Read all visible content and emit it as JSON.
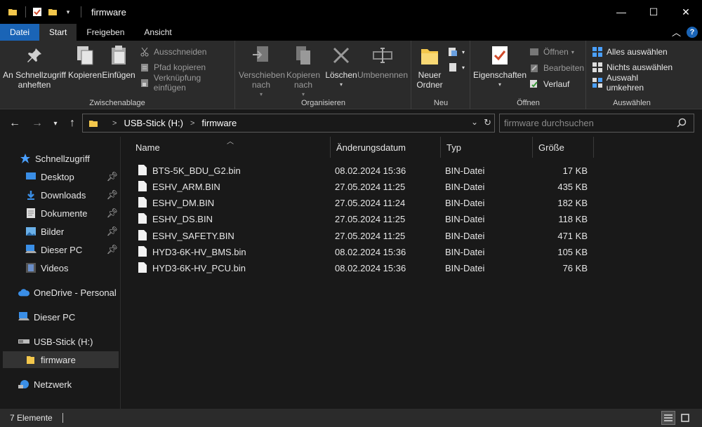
{
  "window": {
    "title": "firmware",
    "controls": {
      "minimize": "—",
      "maximize": "☐",
      "close": "✕"
    }
  },
  "ribbon_tabs": [
    "Datei",
    "Start",
    "Freigeben",
    "Ansicht"
  ],
  "ribbon": {
    "clipboard": {
      "label": "Zwischenablage",
      "pin": "An Schnellzugriff anheften",
      "copy": "Kopieren",
      "paste": "Einfügen",
      "cut": "Ausschneiden",
      "copy_path": "Pfad kopieren",
      "paste_shortcut": "Verknüpfung einfügen"
    },
    "organize": {
      "label": "Organisieren",
      "move_to": "Verschieben nach",
      "copy_to": "Kopieren nach",
      "delete": "Löschen",
      "rename": "Umbenennen"
    },
    "new": {
      "label": "Neu",
      "new_folder": "Neuer Ordner"
    },
    "open": {
      "label": "Öffnen",
      "properties": "Eigenschaften",
      "open": "Öffnen",
      "edit": "Bearbeiten",
      "history": "Verlauf"
    },
    "select": {
      "label": "Auswählen",
      "select_all": "Alles auswählen",
      "select_none": "Nichts auswählen",
      "invert": "Auswahl umkehren"
    }
  },
  "address": {
    "crumbs": [
      "USB-Stick (H:)",
      "firmware"
    ],
    "search_placeholder": "firmware durchsuchen"
  },
  "sidebar": {
    "items": [
      {
        "label": "Schnellzugriff",
        "icon": "star-icon"
      },
      {
        "label": "Desktop",
        "icon": "desktop-icon",
        "pinned": true
      },
      {
        "label": "Downloads",
        "icon": "download-icon",
        "pinned": true
      },
      {
        "label": "Dokumente",
        "icon": "document-icon",
        "pinned": true
      },
      {
        "label": "Bilder",
        "icon": "pictures-icon",
        "pinned": true
      },
      {
        "label": "Dieser PC",
        "icon": "computer-icon",
        "pinned": true
      },
      {
        "label": "Videos",
        "icon": "videos-icon"
      },
      {
        "label": "OneDrive - Personal",
        "icon": "cloud-icon"
      },
      {
        "label": "Dieser PC",
        "icon": "computer-icon"
      },
      {
        "label": "USB-Stick (H:)",
        "icon": "usb-drive-icon"
      },
      {
        "label": "firmware",
        "icon": "folder-icon",
        "selected": true
      },
      {
        "label": "Netzwerk",
        "icon": "network-icon"
      }
    ]
  },
  "columns": [
    "Name",
    "Änderungsdatum",
    "Typ",
    "Größe"
  ],
  "files": [
    {
      "name": "BTS-5K_BDU_G2.bin",
      "date": "08.02.2024 15:36",
      "type": "BIN-Datei",
      "size": "17 KB"
    },
    {
      "name": "ESHV_ARM.BIN",
      "date": "27.05.2024 11:25",
      "type": "BIN-Datei",
      "size": "435 KB"
    },
    {
      "name": "ESHV_DM.BIN",
      "date": "27.05.2024 11:24",
      "type": "BIN-Datei",
      "size": "182 KB"
    },
    {
      "name": "ESHV_DS.BIN",
      "date": "27.05.2024 11:25",
      "type": "BIN-Datei",
      "size": "118 KB"
    },
    {
      "name": "ESHV_SAFETY.BIN",
      "date": "27.05.2024 11:25",
      "type": "BIN-Datei",
      "size": "471 KB"
    },
    {
      "name": "HYD3-6K-HV_BMS.bin",
      "date": "08.02.2024 15:36",
      "type": "BIN-Datei",
      "size": "105 KB"
    },
    {
      "name": "HYD3-6K-HV_PCU.bin",
      "date": "08.02.2024 15:36",
      "type": "BIN-Datei",
      "size": "76 KB"
    }
  ],
  "status": {
    "count": "7 Elemente"
  },
  "colors": {
    "accent": "#1a64b6",
    "folder": "#f3c74c",
    "background": "#191919",
    "ribbon": "#2b2b2b"
  }
}
